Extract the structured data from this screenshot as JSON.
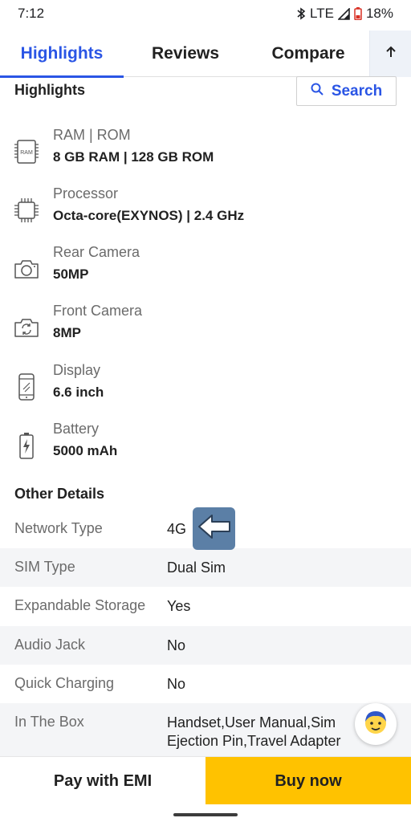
{
  "status_bar": {
    "time": "7:12",
    "network": "LTE",
    "battery": "18%",
    "icons": [
      "bluetooth-icon",
      "signal-icon",
      "battery-icon"
    ]
  },
  "tabs": [
    {
      "label": "Highlights",
      "active": true
    },
    {
      "label": "Reviews",
      "active": false
    },
    {
      "label": "Compare",
      "active": false
    }
  ],
  "scroll_top_icon": "arrow-up-icon",
  "highlights": {
    "title": "Highlights",
    "search_label": "Search",
    "specs": [
      {
        "icon": "ram-chip-icon",
        "label": "RAM | ROM",
        "value": "8 GB RAM | 128 GB ROM",
        "icon_text": "RAM"
      },
      {
        "icon": "processor-icon",
        "label": "Processor",
        "value": "Octa-core(EXYNOS) | 2.4 GHz"
      },
      {
        "icon": "camera-icon",
        "label": "Rear Camera",
        "value": "50MP"
      },
      {
        "icon": "front-camera-icon",
        "label": "Front Camera",
        "value": "8MP"
      },
      {
        "icon": "phone-display-icon",
        "label": "Display",
        "value": "6.6 inch"
      },
      {
        "icon": "battery-charge-icon",
        "label": "Battery",
        "value": "5000 mAh"
      }
    ]
  },
  "other_details": {
    "title": "Other Details",
    "rows": [
      {
        "key": "Network Type",
        "value": "4G"
      },
      {
        "key": "SIM Type",
        "value": "Dual Sim"
      },
      {
        "key": "Expandable Storage",
        "value": "Yes"
      },
      {
        "key": "Audio Jack",
        "value": "No"
      },
      {
        "key": "Quick Charging",
        "value": "No"
      },
      {
        "key": "In The Box",
        "value": "Handset,User Manual,Sim Ejection Pin,Travel Adapter"
      }
    ]
  },
  "overlay": {
    "back_icon": "back-arrow-icon",
    "assistant_icon": "assistant-avatar-icon"
  },
  "actions": {
    "emi_label": "Pay with EMI",
    "buy_label": "Buy now",
    "buy_color": "#ffc200",
    "accent_color": "#2a55e5"
  }
}
